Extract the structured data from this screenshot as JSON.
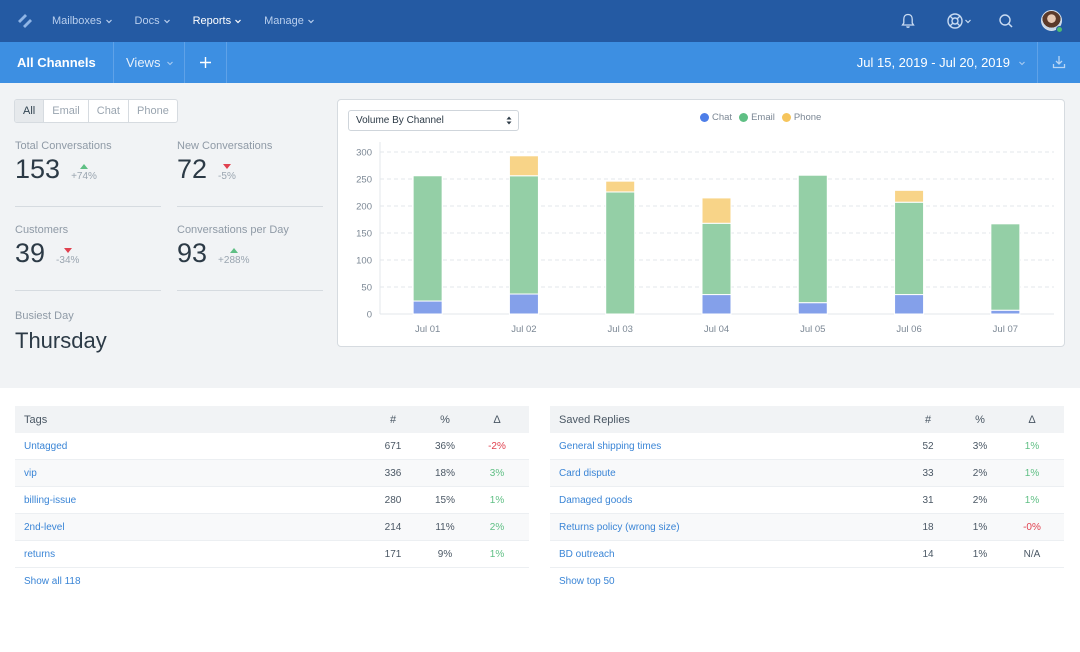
{
  "topnav": {
    "logo": "helpscout-logo-icon",
    "items": [
      {
        "label": "Mailboxes",
        "active": false
      },
      {
        "label": "Docs",
        "active": false
      },
      {
        "label": "Reports",
        "active": true
      },
      {
        "label": "Manage",
        "active": false
      }
    ],
    "icons": [
      "bell-icon",
      "help-lifebuoy-icon",
      "search-icon"
    ],
    "avatar_status": "online"
  },
  "subnav": {
    "title": "All Channels",
    "views_label": "Views",
    "add_label": "+",
    "date_range": "Jul 15, 2019 - Jul 20, 2019"
  },
  "channel_filter": {
    "options": [
      "All",
      "Email",
      "Chat",
      "Phone"
    ],
    "selected": "All"
  },
  "stats": [
    {
      "label": "Total Conversations",
      "value": "153",
      "delta": "+74%",
      "direction": "up"
    },
    {
      "label": "New Conversations",
      "value": "72",
      "delta": "-5%",
      "direction": "down"
    },
    {
      "label": "Customers",
      "value": "39",
      "delta": "-34%",
      "direction": "down"
    },
    {
      "label": "Conversations per Day",
      "value": "93",
      "delta": "+288%",
      "direction": "up"
    }
  ],
  "busiest_day": {
    "label": "Busiest Day",
    "value": "Thursday"
  },
  "chart_select": {
    "value": "Volume By Channel"
  },
  "colors": {
    "chat": "#84a0ea",
    "email": "#94cfa6",
    "phone": "#f8d488",
    "chat_dot": "#4d7ee8",
    "email_dot": "#5fbf84",
    "phone_dot": "#f6c55c"
  },
  "chart_data": {
    "type": "bar",
    "stacked": true,
    "title": "Volume By Channel",
    "categories": [
      "Jul 01",
      "Jul 02",
      "Jul 03",
      "Jul 04",
      "Jul 05",
      "Jul 06",
      "Jul 07"
    ],
    "series": [
      {
        "name": "Chat",
        "values": [
          24,
          37,
          0,
          36,
          21,
          36,
          7
        ]
      },
      {
        "name": "Email",
        "values": [
          232,
          219,
          226,
          132,
          236,
          171,
          160
        ]
      },
      {
        "name": "Phone",
        "values": [
          0,
          37,
          20,
          47,
          0,
          22,
          0
        ]
      }
    ],
    "yticks": [
      0,
      50,
      100,
      150,
      200,
      250,
      300
    ],
    "ylim": [
      0,
      300
    ],
    "grid": true,
    "legend": "top-center",
    "xlabel": "",
    "ylabel": ""
  },
  "tags_table": {
    "headers": {
      "name": "Tags",
      "count": "#",
      "pct": "%",
      "delta": "Δ"
    },
    "rows": [
      {
        "name": "Untagged",
        "count": "671",
        "pct": "36%",
        "delta": "-2%",
        "trend": "neg"
      },
      {
        "name": "vip",
        "count": "336",
        "pct": "18%",
        "delta": "3%",
        "trend": "pos"
      },
      {
        "name": "billing-issue",
        "count": "280",
        "pct": "15%",
        "delta": "1%",
        "trend": "pos"
      },
      {
        "name": "2nd-level",
        "count": "214",
        "pct": "11%",
        "delta": "2%",
        "trend": "pos"
      },
      {
        "name": "returns",
        "count": "171",
        "pct": "9%",
        "delta": "1%",
        "trend": "pos"
      }
    ],
    "footer": "Show all 118"
  },
  "replies_table": {
    "headers": {
      "name": "Saved Replies",
      "count": "#",
      "pct": "%",
      "delta": "Δ"
    },
    "rows": [
      {
        "name": "General shipping times",
        "count": "52",
        "pct": "3%",
        "delta": "1%",
        "trend": "pos"
      },
      {
        "name": "Card dispute",
        "count": "33",
        "pct": "2%",
        "delta": "1%",
        "trend": "pos"
      },
      {
        "name": "Damaged goods",
        "count": "31",
        "pct": "2%",
        "delta": "1%",
        "trend": "pos"
      },
      {
        "name": "Returns policy (wrong size)",
        "count": "18",
        "pct": "1%",
        "delta": "-0%",
        "trend": "neg"
      },
      {
        "name": "BD outreach",
        "count": "14",
        "pct": "1%",
        "delta": "N/A",
        "trend": "neutral"
      }
    ],
    "footer": "Show top 50"
  }
}
